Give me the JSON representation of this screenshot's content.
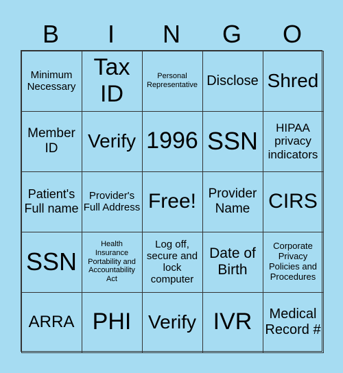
{
  "header": [
    "B",
    "I",
    "N",
    "G",
    "O"
  ],
  "colors": {
    "background": "#a6dcf2",
    "border": "#333333"
  },
  "cells": [
    {
      "text": "Minimum Necessary",
      "size": 15
    },
    {
      "text": "Tax ID",
      "size": 34
    },
    {
      "text": "Personal Representative",
      "size": 11
    },
    {
      "text": "Disclose",
      "size": 20
    },
    {
      "text": "Shred",
      "size": 28
    },
    {
      "text": "Member ID",
      "size": 19
    },
    {
      "text": "Verify",
      "size": 28
    },
    {
      "text": "1996",
      "size": 34
    },
    {
      "text": "SSN",
      "size": 36
    },
    {
      "text": "HIPAA privacy indicators",
      "size": 17
    },
    {
      "text": "Patient's Full name",
      "size": 18
    },
    {
      "text": "Provider's Full Address",
      "size": 15
    },
    {
      "text": "Free!",
      "size": 30
    },
    {
      "text": "Provider Name",
      "size": 19
    },
    {
      "text": "CIRS",
      "size": 30
    },
    {
      "text": "SSN",
      "size": 36
    },
    {
      "text": "Health Insurance Portability and Accountability Act",
      "size": 11
    },
    {
      "text": "Log off, secure and lock computer",
      "size": 15
    },
    {
      "text": "Date of Birth",
      "size": 21
    },
    {
      "text": "Corporate Privacy Policies and Procedures",
      "size": 13
    },
    {
      "text": "ARRA",
      "size": 24
    },
    {
      "text": "PHI",
      "size": 34
    },
    {
      "text": "Verify",
      "size": 28
    },
    {
      "text": "IVR",
      "size": 34
    },
    {
      "text": "Medical Record #",
      "size": 20
    }
  ]
}
